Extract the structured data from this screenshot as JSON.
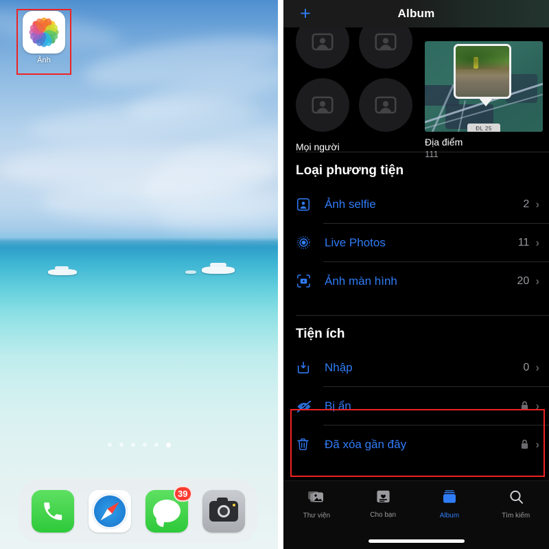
{
  "home_screen": {
    "app": {
      "label": "Ảnh",
      "icon": "photos-app-icon"
    },
    "page_dots": {
      "count": 6,
      "active_index": 5
    },
    "dock": [
      {
        "name": "phone",
        "icon": "phone-icon"
      },
      {
        "name": "safari",
        "icon": "compass-icon"
      },
      {
        "name": "messages",
        "icon": "message-bubble-icon",
        "badge": "39"
      },
      {
        "name": "camera",
        "icon": "camera-icon"
      }
    ]
  },
  "photos_app": {
    "nav": {
      "add_label": "+",
      "title": "Album"
    },
    "top_grid": {
      "people": {
        "label": "Mọi người",
        "icon": "person-placeholder-icon"
      },
      "places": {
        "label": "Địa điểm",
        "count": "111",
        "map_plate": "ĐL 25"
      }
    },
    "sections": [
      {
        "heading": "Loại phương tiện",
        "rows": [
          {
            "label": "Ảnh selfie",
            "count": "2",
            "icon": "selfie-icon",
            "locked": false,
            "chevron": "›"
          },
          {
            "label": "Live Photos",
            "count": "11",
            "icon": "live-photos-icon",
            "locked": false,
            "chevron": "›"
          },
          {
            "label": "Ảnh màn hình",
            "count": "20",
            "icon": "screenshot-icon",
            "locked": false,
            "chevron": "›"
          }
        ]
      },
      {
        "heading": "Tiện ích",
        "rows": [
          {
            "label": "Nhập",
            "count": "0",
            "icon": "import-icon",
            "locked": false,
            "chevron": "›"
          },
          {
            "label": "Bị ẩn",
            "count": "",
            "icon": "eye-slash-icon",
            "locked": true,
            "chevron": "›"
          },
          {
            "label": "Đã xóa gần đây",
            "count": "",
            "icon": "trash-icon",
            "locked": true,
            "chevron": "›"
          }
        ]
      }
    ],
    "tabs": [
      {
        "label": "Thư viện",
        "icon": "library-icon",
        "active": false
      },
      {
        "label": "Cho bạn",
        "icon": "for-you-icon",
        "active": false
      },
      {
        "label": "Album",
        "icon": "albums-icon",
        "active": true
      },
      {
        "label": "Tìm kiếm",
        "icon": "search-icon",
        "active": false
      }
    ]
  },
  "annotations": {
    "highlight_color": "#ee2222",
    "boxes": [
      "photos-app-icon",
      "hidden-and-recently-deleted-rows"
    ]
  },
  "colors": {
    "accent_blue": "#2f7cf6",
    "secondary_text": "#98989e",
    "background": "#000000",
    "badge_red": "#fb3b30"
  }
}
